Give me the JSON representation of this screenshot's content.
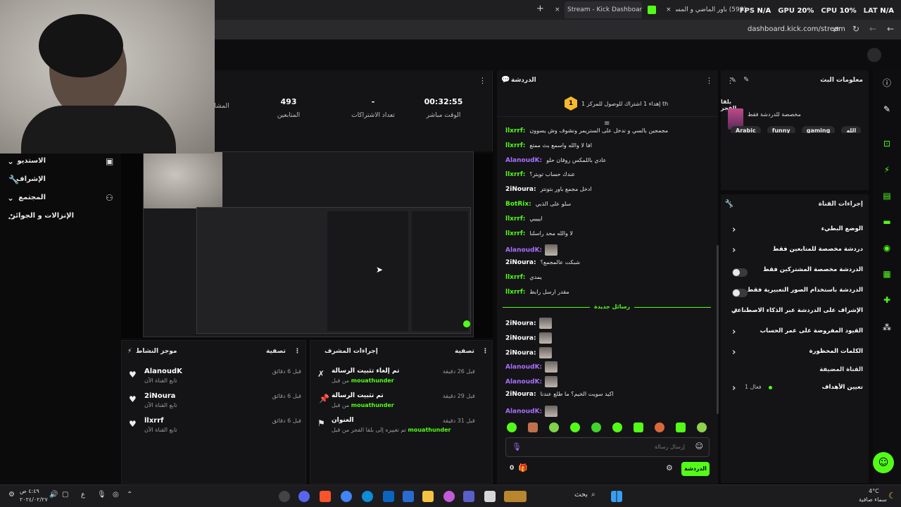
{
  "browser": {
    "tabs": [
      {
        "label": "Stream - Kick Dashboard",
        "active": true
      },
      {
        "label": "(599) باور الماضي و المستقبل",
        "active": false
      }
    ],
    "url": "dashboard.kick.com/stream"
  },
  "hud": {
    "fps_label": "FPS",
    "fps_value": "N/A",
    "gpu_label": "GPU",
    "gpu_value": "20%",
    "cpu_label": "CPU",
    "cpu_value": "10%",
    "lat_label": "LAT",
    "lat_value": "N/A"
  },
  "leftnav": {
    "items": [
      {
        "label": "الاستديو",
        "icon": "studio-icon"
      },
      {
        "label": "الإشراف",
        "icon": "wrench-icon"
      },
      {
        "label": "المجتمع",
        "icon": "community-icon"
      },
      {
        "label": "الإنزالات و الجوائز",
        "icon": "drops-icon"
      }
    ]
  },
  "stats": {
    "items": [
      {
        "value": "00:32:55",
        "label": "الوقت مباشر"
      },
      {
        "value": "-",
        "label": "تعداد الاشتراكات"
      },
      {
        "value": "493",
        "label": "المتابعين"
      },
      {
        "value": "",
        "label": "المشا"
      }
    ]
  },
  "activity": {
    "title": "موجز النشاط",
    "filter": "تصفية",
    "items": [
      {
        "name": "AlanoudK",
        "sub": "تابع القناة الآن",
        "when": "قبل 6 دقائق"
      },
      {
        "name": "2iNoura",
        "sub": "تابع القناة الآن",
        "when": "قبل 6 دقائق"
      },
      {
        "name": "llxrrf",
        "sub": "تابع القناة الآن",
        "when": "قبل 6 دقائق"
      }
    ]
  },
  "modactions": {
    "title": "إجراءات المشرف",
    "filter": "تصفية",
    "items": [
      {
        "title": "تم إلغاء تثبيت الرسالة",
        "by_prefix": "من قبل",
        "by": "mouathunder",
        "when": "قبل 26 دقيقة"
      },
      {
        "title": "تم تثبيت الرسالة",
        "by_prefix": "من قبل",
        "by": "mouathunder",
        "when": "قبل 29 دقيقة"
      },
      {
        "title": "العنوان",
        "by_prefix": "تم تغييره إلى بلقا الفجر من قبل",
        "by": "mouathunder",
        "when": "قبل 31 دقيقة"
      }
    ]
  },
  "chat": {
    "title": "الدردشة",
    "goal": "إهداء 1 اشتراك للوصول للمركز 1 th",
    "goal_badge": "1",
    "new_messages": "رسائل جديدة",
    "input_placeholder": "إرسال رسالة",
    "send_label": "الدردشة",
    "count": "0",
    "messages": [
      {
        "user": "llxrrf",
        "color": "#53fc18",
        "text": "مجمجين بالسي و ندخل على الستريمر ونشوف وش يسوون"
      },
      {
        "user": "llxrrf",
        "color": "#53fc18",
        "text": "افا لا والله واسمع بث ممتع"
      },
      {
        "user": "AlanoudK",
        "color": "#a970ff",
        "text": "عادي باللمكس روقان حلو"
      },
      {
        "user": "llxrrf",
        "color": "#53fc18",
        "text": "عندك حساب تويتر؟"
      },
      {
        "user": "2iNoura",
        "color": "#ffffff",
        "text": "ادخل مجمع باور بتونتر"
      },
      {
        "user": "BotRix",
        "color": "#53fc18",
        "text": "سلو على الذبي"
      },
      {
        "user": "llxrrf",
        "color": "#53fc18",
        "text": "اييييي"
      },
      {
        "user": "llxrrf",
        "color": "#53fc18",
        "text": "لا والله محد راسلنا"
      },
      {
        "user": "AlanoudK",
        "color": "#a970ff",
        "text": ""
      },
      {
        "user": "2iNoura",
        "color": "#ffffff",
        "text": "شبكت عالمجمع؟"
      },
      {
        "user": "llxrrf",
        "color": "#53fc18",
        "text": "يمدي"
      },
      {
        "user": "llxrrf",
        "color": "#53fc18",
        "text": "مقدر ارسل رابط"
      }
    ],
    "new_msgs": [
      {
        "user": "2iNoura",
        "color": "#ffffff",
        "text": ""
      },
      {
        "user": "2iNoura",
        "color": "#ffffff",
        "text": ""
      },
      {
        "user": "2iNoura",
        "color": "#ffffff",
        "text": ""
      },
      {
        "user": "AlanoudK",
        "color": "#a970ff",
        "text": ""
      },
      {
        "user": "AlanoudK",
        "color": "#a970ff",
        "text": ""
      },
      {
        "user": "2iNoura",
        "color": "#ffffff",
        "text": "اكيد سويت الخيم؟ ما طلع عندنا"
      },
      {
        "user": "AlanoudK",
        "color": "#a970ff",
        "text": ""
      }
    ]
  },
  "info": {
    "title": "معلومات البث",
    "stream_title": "بلقا الفجر",
    "category": "مخصصة للدردشة فقط",
    "tags": [
      "Arabic",
      "funny",
      "gaming",
      "الله",
      "ع"
    ]
  },
  "actions": {
    "title": "إجراءات القناة",
    "items": [
      {
        "label": "الوضع البطيء",
        "kind": "chevron"
      },
      {
        "label": "دردشة مخصصة للمتابعين فقط",
        "kind": "chevron"
      },
      {
        "label": "الدردشة مخصصة المشتركين فقط",
        "kind": "toggle"
      },
      {
        "label": "الدردشة باستخدام الصور التعبيرية فقط",
        "kind": "toggle"
      },
      {
        "label": "الإشراف على الدردشة عبر الذكاء الاصطناعي",
        "kind": "external"
      },
      {
        "label": "القيود المفروضة على عمر الحساب",
        "kind": "chevron"
      },
      {
        "label": "الكلمات المحظورة",
        "kind": "chevron"
      }
    ],
    "section": "القناة المضيفة",
    "goals_label": "تعيين الأهداف",
    "goals_status": "فعال 1"
  },
  "taskbar": {
    "search": "بحث",
    "weather_temp": "4°C",
    "weather_desc": "سماء صافية",
    "time": "٤:٤٩ ص",
    "date": "٢٠٢٤/٠٢/٢٧",
    "lang": "ع"
  },
  "colors": {
    "accent": "#53fc18",
    "purple": "#a970ff"
  }
}
